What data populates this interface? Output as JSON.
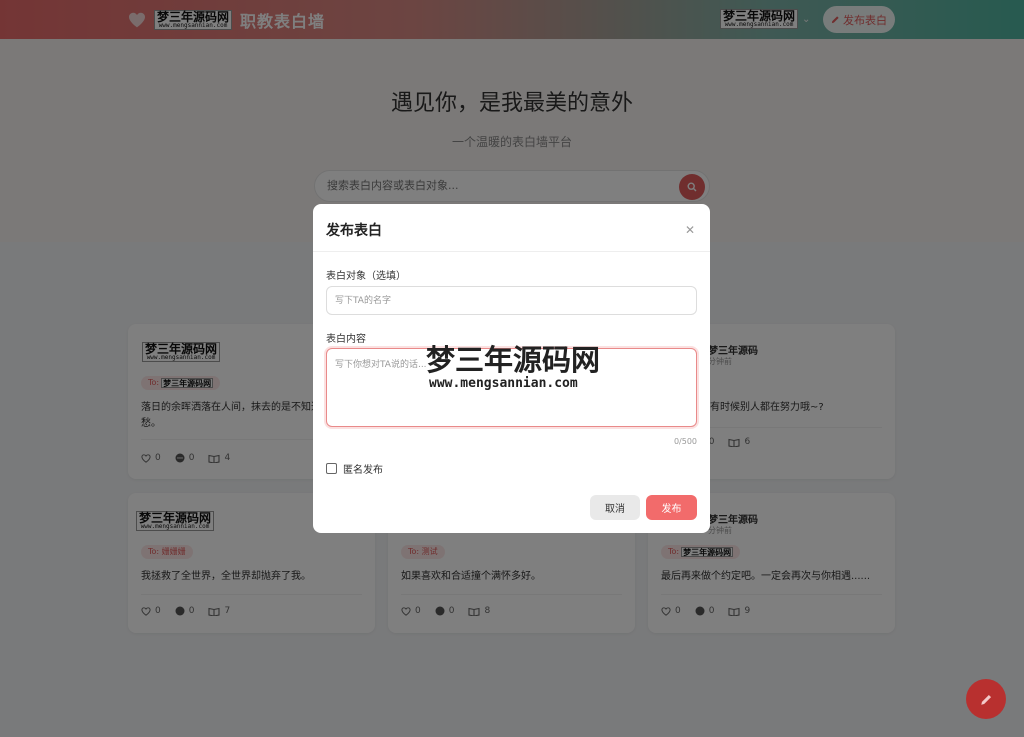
{
  "header": {
    "brand_watermark": "梦三年源码网",
    "brand_watermark_url": "www.mengsannian.com",
    "brand_name": "职教表白墙",
    "user_watermark": "梦三年源码网",
    "user_watermark_url": "www.mengsannian.com",
    "publish_label": "发布表白"
  },
  "hero": {
    "title": "遇见你，是我最美的意外",
    "subtitle": "一个温暖的表白墙平台",
    "search_placeholder": "搜索表白内容或表白对象..."
  },
  "cards": [
    {
      "author_watermark": "梦三年源码网",
      "author_watermark_url": "www.mengsannian.com",
      "to_prefix": "To:",
      "to_watermark": "梦三年源码网",
      "text": "落日的余晖洒落在人间，抹去的是不知道题目的忧愁。",
      "likes": "0",
      "comments": "0",
      "views": "4"
    },
    {
      "author_name": "梦三年源码",
      "time": "分钟前",
      "text": "有时候别人都在努力哦~?",
      "likes": "0",
      "comments": "0",
      "views": "6"
    },
    {
      "author_watermark": "梦三年源码网",
      "author_watermark_url": "www.mengsannian.com",
      "to_label": "To: 姗姗姗",
      "text": "我拯救了全世界，全世界却抛弃了我。",
      "likes": "0",
      "comments": "0",
      "views": "7"
    },
    {
      "to_label": "To: 测试",
      "text": "如果喜欢和合适撞个满怀多好。",
      "likes": "0",
      "comments": "0",
      "views": "8"
    },
    {
      "author_name": "梦三年源码",
      "time": "分钟前",
      "to_prefix": "To:",
      "to_watermark": "梦三年源码网",
      "text": "最后再来做个约定吧。一定会再次与你相遇......",
      "likes": "0",
      "comments": "0",
      "views": "9"
    }
  ],
  "modal": {
    "title": "发布表白",
    "target_label": "表白对象（选填）",
    "target_placeholder": "写下TA的名字",
    "content_label": "表白内容",
    "content_placeholder": "写下你想对TA说的话...",
    "counter": "0/500",
    "anonymous_label": "匿名发布",
    "cancel_label": "取消",
    "publish_label": "发布"
  },
  "watermark": {
    "cn": "梦三年源码网",
    "url": "www.mengsannian.com"
  },
  "colors": {
    "accent": "#e05c5c",
    "publish": "#f26b6b",
    "fab": "#b8302f"
  }
}
